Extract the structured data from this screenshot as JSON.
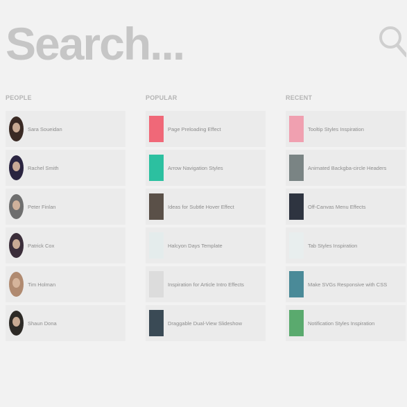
{
  "search": {
    "placeholder": "Search..."
  },
  "icons": {
    "search": "search-icon"
  },
  "columns": [
    {
      "heading": "PEOPLE",
      "items": [
        {
          "label": "Sara Soueidan",
          "color": "#3a2a24"
        },
        {
          "label": "Rachel Smith",
          "color": "#2a2440"
        },
        {
          "label": "Peter Finlan",
          "color": "#6e6e6e"
        },
        {
          "label": "Patrick Cox",
          "color": "#3b2e3a"
        },
        {
          "label": "Tim Holman",
          "color": "#b08a70"
        },
        {
          "label": "Shaun Dona",
          "color": "#2d2a26"
        }
      ]
    },
    {
      "heading": "POPULAR",
      "items": [
        {
          "label": "Page Preloading Effect",
          "color": "#f06878"
        },
        {
          "label": "Arrow Navigation Styles",
          "color": "#2cc0a0"
        },
        {
          "label": "Ideas for Subtle Hover Effect",
          "color": "#5a5048"
        },
        {
          "label": "Halcyon Days Template",
          "color": "#e4ecec"
        },
        {
          "label": "Inspiration for Article Intro Effects",
          "color": "#dcdcdc"
        },
        {
          "label": "Draggable Dual-View Slideshow",
          "color": "#3a4a55"
        }
      ]
    },
    {
      "heading": "RECENT",
      "items": [
        {
          "label": "Tooltip Styles Inspiration",
          "color": "#f0a0b0"
        },
        {
          "label": "Animated Backgba-circle Headers",
          "color": "#7a8484"
        },
        {
          "label": "Off-Canvas Menu Effects",
          "color": "#2e3440"
        },
        {
          "label": "Tab Styles Inspiration",
          "color": "#e8eeee"
        },
        {
          "label": "Make SVGs Responsive with CSS",
          "color": "#4a8a98"
        },
        {
          "label": "Notification Styles Inspiration",
          "color": "#5aaa6e"
        }
      ]
    }
  ]
}
